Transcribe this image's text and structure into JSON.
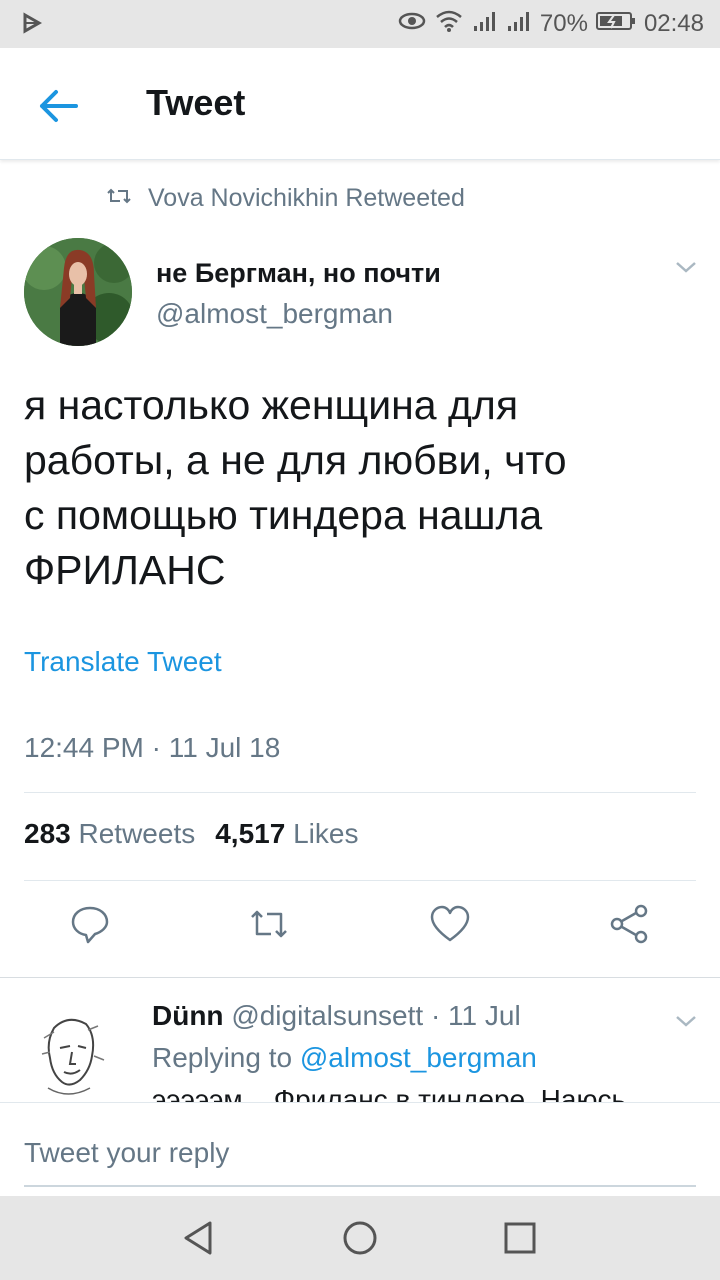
{
  "status_bar": {
    "battery": "70%",
    "time": "02:48"
  },
  "header": {
    "title": "Tweet"
  },
  "retweet_context": "Vova Novichikhin Retweeted",
  "tweet": {
    "author_name": "не Бергман, но почти",
    "author_handle": "@almost_bergman",
    "text": "я настолько женщина для\nработы, а не для любви, что\nс помощью тиндера нашла\nФРИЛАНС",
    "translate_label": "Translate Tweet",
    "timestamp": "12:44 PM · 11 Jul 18",
    "retweets_count": "283",
    "retweets_label": "Retweets",
    "likes_count": "4,517",
    "likes_label": "Likes"
  },
  "reply": {
    "name": "Dünn",
    "handle": "@digitalsunsett",
    "date": "· 11 Jul",
    "replying_to_label": "Replying to",
    "replying_to_handle": "@almost_bergman",
    "text": "эээээм... Фриланс в тиндере. Наюсь"
  },
  "reply_box": {
    "placeholder": "Tweet your reply"
  },
  "colors": {
    "accent": "#1b95e0",
    "secondary_text": "#657786",
    "icon": "#657786"
  }
}
